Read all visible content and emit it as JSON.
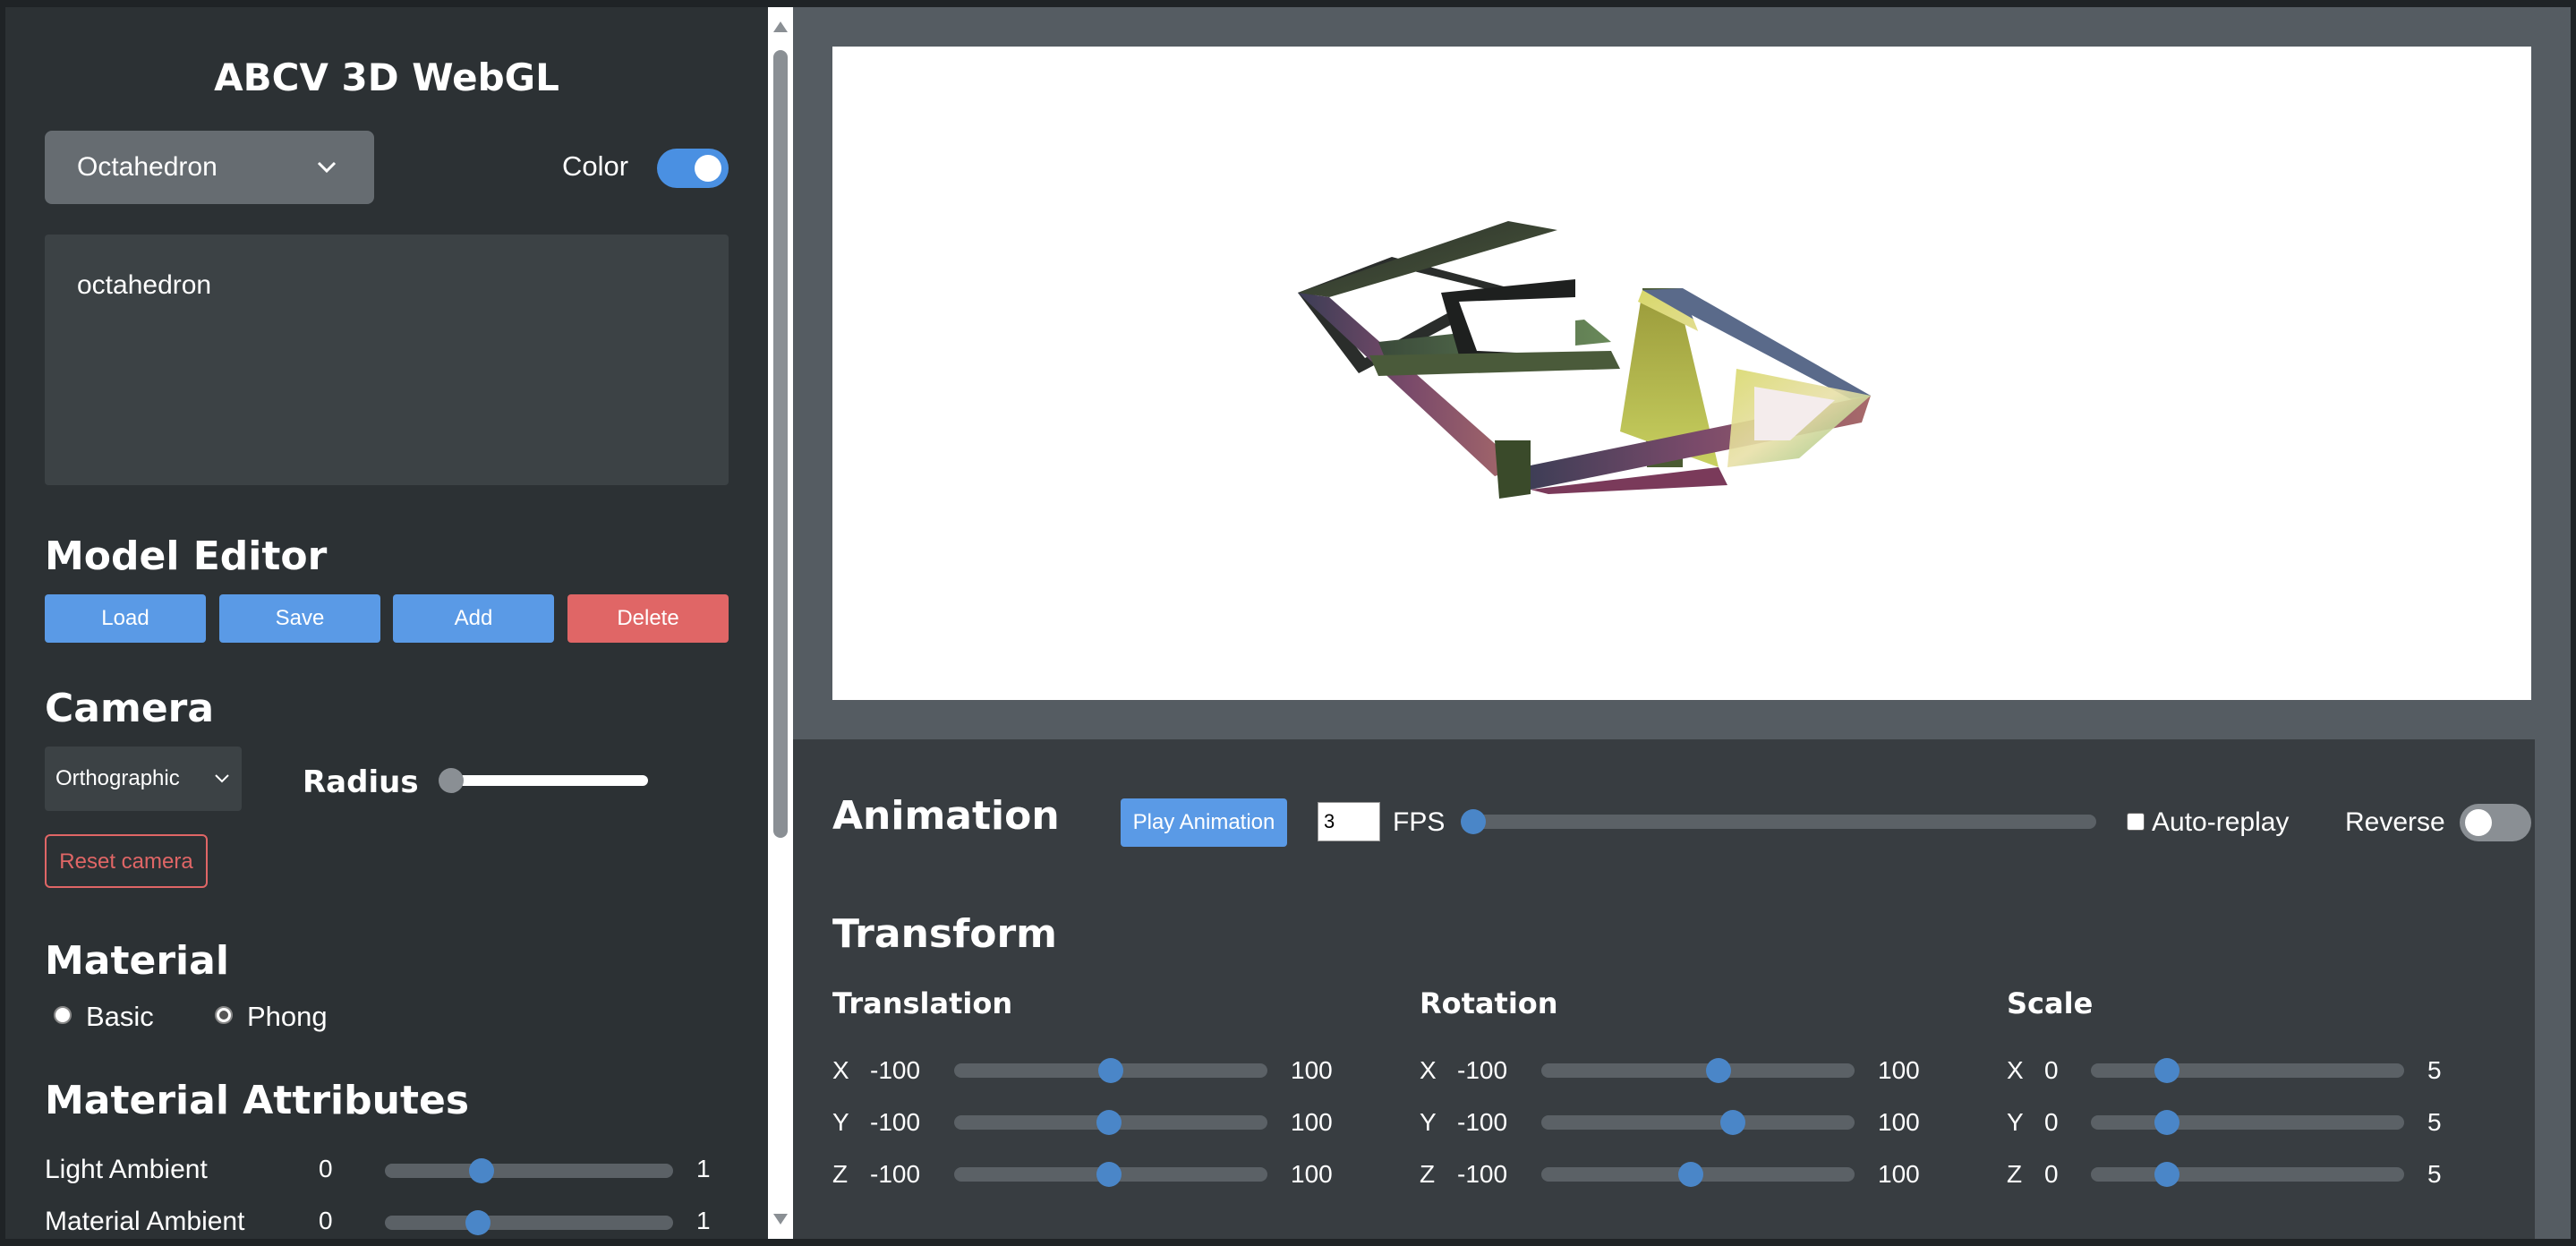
{
  "app": {
    "title": "ABCV 3D WebGL"
  },
  "model": {
    "selected": "Octahedron",
    "color_label": "Color",
    "color_on": true,
    "description": "octahedron"
  },
  "model_editor": {
    "title": "Model Editor",
    "load": "Load",
    "save": "Save",
    "add": "Add",
    "delete": "Delete"
  },
  "camera": {
    "title": "Camera",
    "projection": "Orthographic",
    "radius_label": "Radius",
    "radius_value": 0,
    "reset": "Reset camera"
  },
  "material": {
    "title": "Material",
    "options": [
      "Basic",
      "Phong"
    ],
    "selected": "Phong"
  },
  "material_attributes": {
    "title": "Material Attributes",
    "items": [
      {
        "label": "Light Ambient",
        "min": "0",
        "max": "1",
        "value": 0.34
      },
      {
        "label": "Material Ambient",
        "min": "0",
        "max": "1",
        "value": 0.32
      }
    ]
  },
  "animation": {
    "title": "Animation",
    "play": "Play Animation",
    "fps_value": "3",
    "fps_label": "FPS",
    "frame_value": 0,
    "auto_replay": "Auto-replay",
    "auto_replay_checked": false,
    "reverse": "Reverse",
    "reverse_on": false
  },
  "transform": {
    "title": "Transform",
    "translation": {
      "title": "Translation",
      "axes": [
        {
          "axis": "X",
          "min": "-100",
          "max": "100",
          "value": 0
        },
        {
          "axis": "Y",
          "min": "-100",
          "max": "100",
          "value": -1
        },
        {
          "axis": "Z",
          "min": "-100",
          "max": "100",
          "value": -1
        }
      ]
    },
    "rotation": {
      "title": "Rotation",
      "axes": [
        {
          "axis": "X",
          "min": "-100",
          "max": "100",
          "value": 14
        },
        {
          "axis": "Y",
          "min": "-100",
          "max": "100",
          "value": 24
        },
        {
          "axis": "Z",
          "min": "-100",
          "max": "100",
          "value": -5
        }
      ]
    },
    "scale": {
      "title": "Scale",
      "axes": [
        {
          "axis": "X",
          "min": "0",
          "max": "5",
          "value": 1.1
        },
        {
          "axis": "Y",
          "min": "0",
          "max": "5",
          "value": 1.1
        },
        {
          "axis": "Z",
          "min": "0",
          "max": "5",
          "value": 1.1
        }
      ]
    }
  },
  "colors": {
    "accent": "#4a90e2",
    "button_blue": "#5a9ae6",
    "danger": "#e06666",
    "sidebar_bg": "#2c3134",
    "panel_bg": "#383d41"
  }
}
